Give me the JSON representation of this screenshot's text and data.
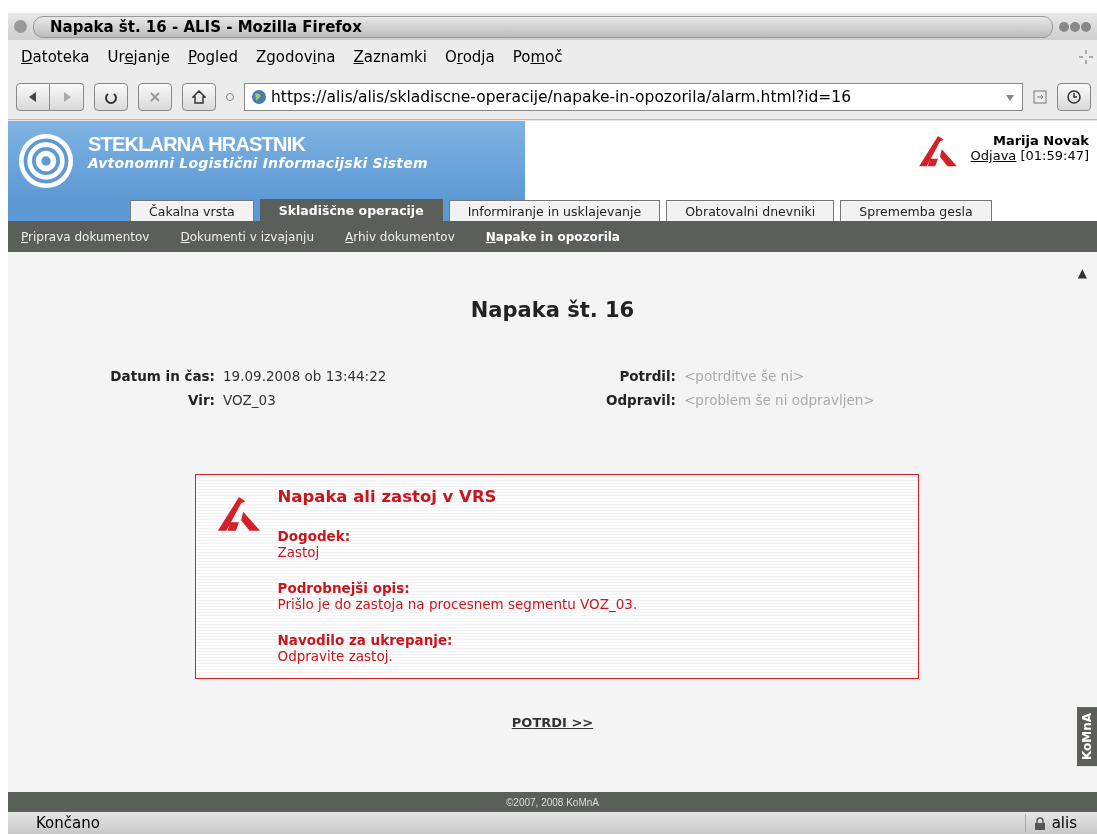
{
  "window": {
    "title": "Napaka št. 16 - ALIS - Mozilla Firefox"
  },
  "menu": [
    {
      "access_key": "D",
      "after_key": "atoteka"
    },
    {
      "before_key": "Ur",
      "access_key": "e",
      "after_key": "janje"
    },
    {
      "access_key": "P",
      "after_key": "ogled"
    },
    {
      "before_key": "Zgodov",
      "access_key": "i",
      "after_key": "na"
    },
    {
      "access_key": "Z",
      "after_key": "aznamki"
    },
    {
      "before_key": "O",
      "access_key": "r",
      "after_key": "odja"
    },
    {
      "before_key": "Po",
      "access_key": "m",
      "after_key": "oč"
    }
  ],
  "address": {
    "value": "https://alis/alis/skladiscne-operacije/napake-in-opozorila/alarm.html?id=16"
  },
  "header": {
    "company": "STEKLARNA HRASTNIK",
    "system": "Avtonomni Logistični Informacijski Sistem",
    "user": "Marija Novak",
    "logout": "Odjava",
    "timer": "[01:59:47]"
  },
  "tabs": [
    {
      "label": "Čakalna vrsta",
      "selected": false
    },
    {
      "label": "Skladiščne operacije",
      "selected": true
    },
    {
      "label": "Informiranje in usklajevanje",
      "selected": false
    },
    {
      "label": "Obratovalni dnevniki",
      "selected": false
    },
    {
      "label": "Sprememba gesla",
      "selected": false
    }
  ],
  "subnav": [
    {
      "label": "Priprava dokumentov",
      "selected": false
    },
    {
      "label": "Dokumenti v izvajanju",
      "selected": false
    },
    {
      "label": "Arhiv dokumentov",
      "selected": false
    },
    {
      "label": "Napake in opozorila",
      "selected": true
    }
  ],
  "scroll_top": "▲",
  "title": "Napaka št. 16",
  "details": [
    {
      "label": "Datum in čas:",
      "value": "19.09.2008 ob 13:44:22",
      "empty": false
    },
    {
      "label": "Potrdil:",
      "value": "<potrditve še ni>",
      "empty": true
    },
    {
      "label": "Vir:",
      "value": "VOZ_03",
      "empty": false
    },
    {
      "label": "Odpravil:",
      "value": "<problem še ni odpravljen>",
      "empty": true
    }
  ],
  "alarm": {
    "heading": "Napaka ali zastoj v VRS",
    "sections": [
      {
        "label": "Dogodek:",
        "text": "Zastoj"
      },
      {
        "label": "Podrobnejši opis:",
        "text": "Prišlo je do zastoja na procesnem segmentu VOZ_03."
      },
      {
        "label": "Navodilo za ukrepanje:",
        "text": "Odpravite zastoj."
      }
    ]
  },
  "confirm": {
    "before_key": "P",
    "access_key": "O",
    "after_key": "TRDI >>"
  },
  "side_tab": "KoMnA",
  "footer": "©2007, 2008 KoMnA",
  "status_bar": {
    "text": "Končano",
    "site": "alis"
  }
}
